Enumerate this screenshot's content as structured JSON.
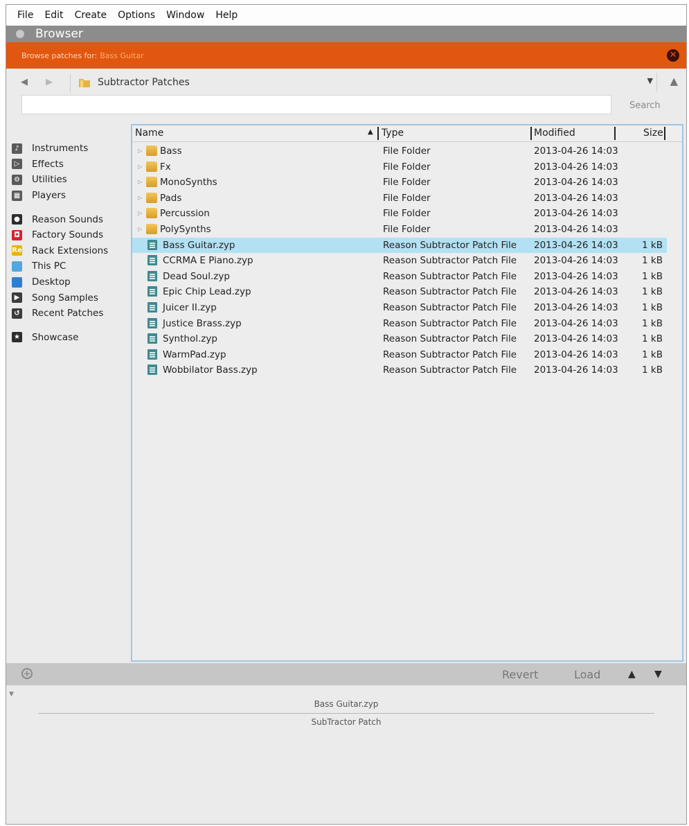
{
  "menu": [
    "File",
    "Edit",
    "Create",
    "Options",
    "Window",
    "Help"
  ],
  "window": {
    "title": "Browser"
  },
  "browse_bar": {
    "label": "Browse patches for:",
    "value": "Bass Guitar",
    "color": "#e2570f"
  },
  "nav": {
    "path": "Subtractor Patches"
  },
  "search": {
    "value": "",
    "placeholder": "",
    "label": "Search"
  },
  "sidebar": {
    "items": [
      {
        "label": "Instruments",
        "icon": "instruments-icon",
        "color": "#5a5a5a"
      },
      {
        "label": "Effects",
        "icon": "effects-icon",
        "color": "#5a5a5a"
      },
      {
        "label": "Utilities",
        "icon": "utilities-icon",
        "color": "#5a5a5a"
      },
      {
        "label": "Players",
        "icon": "players-icon",
        "color": "#5a5a5a"
      },
      {
        "label": "Reason Sounds",
        "icon": "reason-sounds-icon",
        "color": "#2d2d2d"
      },
      {
        "label": "Factory Sounds",
        "icon": "factory-sounds-icon",
        "color": "#d9232d"
      },
      {
        "label": "Rack Extensions",
        "icon": "rack-extensions-icon",
        "color": "#e8b400"
      },
      {
        "label": "This PC",
        "icon": "this-pc-icon",
        "color": "#53a7e0"
      },
      {
        "label": "Desktop",
        "icon": "desktop-icon",
        "color": "#2d7fd3"
      },
      {
        "label": "Song Samples",
        "icon": "song-samples-icon",
        "color": "#3c3c3c"
      },
      {
        "label": "Recent Patches",
        "icon": "recent-patches-icon",
        "color": "#3c3c3c"
      },
      {
        "label": "Showcase",
        "icon": "showcase-icon",
        "color": "#2d2d2d"
      }
    ]
  },
  "table": {
    "headers": {
      "name": "Name",
      "type": "Type",
      "modified": "Modified",
      "size": "Size"
    },
    "rows": [
      {
        "kind": "folder",
        "name": "Bass",
        "type": "File Folder",
        "modified": "2013-04-26 14:03",
        "size": ""
      },
      {
        "kind": "folder",
        "name": "Fx",
        "type": "File Folder",
        "modified": "2013-04-26 14:03",
        "size": ""
      },
      {
        "kind": "folder",
        "name": "MonoSynths",
        "type": "File Folder",
        "modified": "2013-04-26 14:03",
        "size": ""
      },
      {
        "kind": "folder",
        "name": "Pads",
        "type": "File Folder",
        "modified": "2013-04-26 14:03",
        "size": ""
      },
      {
        "kind": "folder",
        "name": "Percussion",
        "type": "File Folder",
        "modified": "2013-04-26 14:03",
        "size": ""
      },
      {
        "kind": "folder",
        "name": "PolySynths",
        "type": "File Folder",
        "modified": "2013-04-26 14:03",
        "size": ""
      },
      {
        "kind": "file",
        "name": "Bass Guitar.zyp",
        "type": "Reason Subtractor Patch File",
        "modified": "2013-04-26 14:03",
        "size": "1 kB",
        "selected": true
      },
      {
        "kind": "file",
        "name": "CCRMA E Piano.zyp",
        "type": "Reason Subtractor Patch File",
        "modified": "2013-04-26 14:03",
        "size": "1 kB"
      },
      {
        "kind": "file",
        "name": "Dead Soul.zyp",
        "type": "Reason Subtractor Patch File",
        "modified": "2013-04-26 14:03",
        "size": "1 kB"
      },
      {
        "kind": "file",
        "name": "Epic Chip Lead.zyp",
        "type": "Reason Subtractor Patch File",
        "modified": "2013-04-26 14:03",
        "size": "1 kB"
      },
      {
        "kind": "file",
        "name": "Juicer II.zyp",
        "type": "Reason Subtractor Patch File",
        "modified": "2013-04-26 14:03",
        "size": "1 kB"
      },
      {
        "kind": "file",
        "name": "Justice Brass.zyp",
        "type": "Reason Subtractor Patch File",
        "modified": "2013-04-26 14:03",
        "size": "1 kB"
      },
      {
        "kind": "file",
        "name": "Synthol.zyp",
        "type": "Reason Subtractor Patch File",
        "modified": "2013-04-26 14:03",
        "size": "1 kB"
      },
      {
        "kind": "file",
        "name": "WarmPad.zyp",
        "type": "Reason Subtractor Patch File",
        "modified": "2013-04-26 14:03",
        "size": "1 kB"
      },
      {
        "kind": "file",
        "name": "Wobbilator Bass.zyp",
        "type": "Reason Subtractor Patch File",
        "modified": "2013-04-26 14:03",
        "size": "1 kB"
      }
    ]
  },
  "toolbar": {
    "revert": "Revert",
    "load": "Load"
  },
  "info": {
    "name": "Bass Guitar.zyp",
    "type": "SubTractor Patch"
  }
}
